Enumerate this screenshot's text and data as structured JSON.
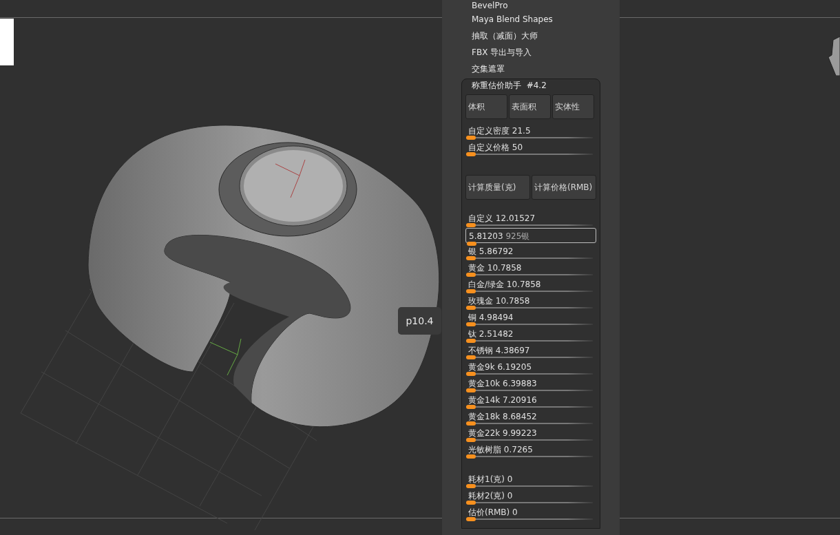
{
  "menu_items": [
    "BevelPro",
    "Maya Blend Shapes",
    "抽取（减面）大师",
    "FBX 导出与导入",
    "交集遮罩"
  ],
  "plugin": {
    "title": "称重估价助手",
    "version": "#4.2",
    "mode_buttons": [
      "体积",
      "表面积",
      "实体性"
    ],
    "settings": [
      {
        "kind": "slider",
        "label": "自定义密度",
        "value": "21.5",
        "level": 0
      },
      {
        "kind": "slider",
        "label": "自定义价格",
        "value": "50",
        "level": 0
      }
    ],
    "calc_buttons": [
      "计算质量(克)",
      "计算价格(RMB)"
    ],
    "results": [
      {
        "kind": "slider",
        "label": "自定义",
        "value": "12.01527",
        "level": 0
      },
      {
        "kind": "input",
        "value": "5.81203",
        "label": "925银",
        "level": 0
      },
      {
        "kind": "slider",
        "label": "银",
        "value": "5.86792",
        "level": 0
      },
      {
        "kind": "slider",
        "label": "黄金",
        "value": "10.7858",
        "level": 0
      },
      {
        "kind": "slider",
        "label": "白金/绿金",
        "value": "10.7858",
        "level": 0
      },
      {
        "kind": "slider",
        "label": "玫瑰金",
        "value": "10.7858",
        "level": 0
      },
      {
        "kind": "slider",
        "label": "铜",
        "value": "4.98494",
        "level": 0
      },
      {
        "kind": "slider",
        "label": "钛",
        "value": "2.51482",
        "level": 0
      },
      {
        "kind": "slider",
        "label": "不锈钢",
        "value": "4.38697",
        "level": 0
      },
      {
        "kind": "slider",
        "label": "黄金9k",
        "value": "6.19205",
        "level": 0
      },
      {
        "kind": "slider",
        "label": "黄金10k",
        "value": "6.39883",
        "level": 0
      },
      {
        "kind": "slider",
        "label": "黄金14k",
        "value": "7.20916",
        "level": 0
      },
      {
        "kind": "slider",
        "label": "黄金18k",
        "value": "8.68452",
        "level": 0
      },
      {
        "kind": "slider",
        "label": "黄金22k",
        "value": "9.99223",
        "level": 0
      },
      {
        "kind": "slider",
        "label": "光敏树脂",
        "value": "0.7265",
        "level": 0
      }
    ],
    "consumables": [
      {
        "kind": "slider",
        "label": "耗材1(克)",
        "value": "0",
        "level": 0
      },
      {
        "kind": "slider",
        "label": "耗材2(克)",
        "value": "0",
        "level": 0
      },
      {
        "kind": "slider",
        "label": "估价(RMB)",
        "value": "0",
        "level": 0
      }
    ]
  },
  "tooltip": "p10.4"
}
